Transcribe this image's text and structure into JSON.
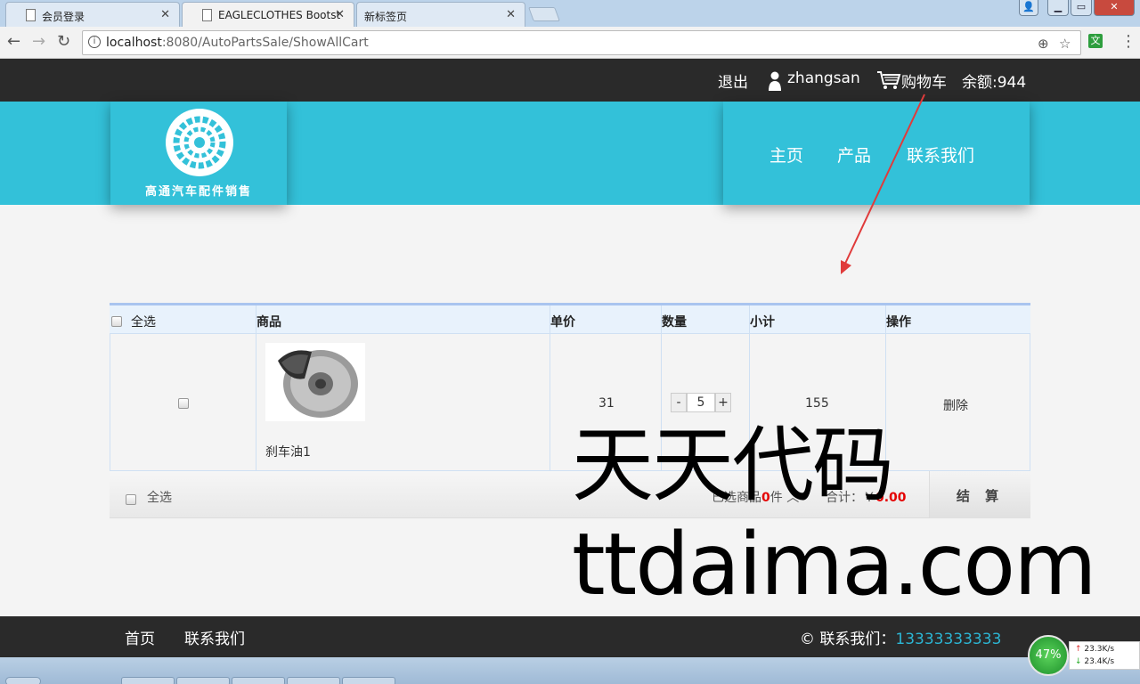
{
  "browser": {
    "tabs": [
      {
        "title": "会员登录",
        "active": false
      },
      {
        "title": "EAGLECLOTHES Bootst",
        "active": true
      },
      {
        "title": "新标签页",
        "active": false
      }
    ],
    "url_host": "localhost",
    "url_path": ":8080/AutoPartsSale/ShowAllCart"
  },
  "topbar": {
    "logout": "退出",
    "username": "zhangsan",
    "cart": "购物车",
    "balance": "余额:944"
  },
  "header": {
    "logo_text": "高通汽车配件销售",
    "nav": [
      "主页",
      "产品",
      "联系我们"
    ],
    "accent_color": "#33c1d9"
  },
  "cart": {
    "columns": {
      "select_all": "全选",
      "product": "商品",
      "unit_price": "单价",
      "quantity": "数量",
      "subtotal": "小计",
      "action": "操作"
    },
    "items": [
      {
        "name": "刹车油1",
        "unit_price": "31",
        "quantity": "5",
        "subtotal": "155",
        "action": "删除"
      }
    ],
    "qty_minus": "-",
    "qty_plus": "+",
    "footer": {
      "select_all": "全选",
      "selected_prefix": "已选商品",
      "selected_count": "0",
      "selected_suffix": "件",
      "total_label": "合计：",
      "currency": "￥",
      "total": "0.00",
      "checkout": "结 算"
    }
  },
  "watermark": {
    "line1": "天天代码",
    "line2": "ttdaima.com"
  },
  "footer": {
    "home": "首页",
    "contact": "联系我们",
    "copyright_label": "© 联系我们：",
    "phone": "13333333333"
  },
  "tray": {
    "percent": "47%",
    "upload": "23.3K/s",
    "download": "23.4K/s"
  }
}
